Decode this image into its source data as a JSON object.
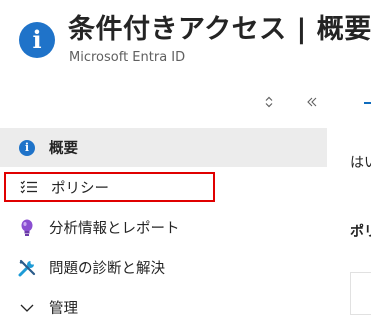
{
  "header": {
    "title": "条件付きアクセス | 概要",
    "subtitle": "Microsoft Entra ID",
    "icon": "info-icon"
  },
  "toolbar": {
    "sort_icon": "sort-up-down-icon",
    "collapse_icon": "double-chevron-left-icon"
  },
  "nav": {
    "items": [
      {
        "label": "概要",
        "icon": "info-icon"
      },
      {
        "label": "ポリシー",
        "icon": "list-icon"
      },
      {
        "label": "分析情報とレポート",
        "icon": "lightbulb-icon"
      },
      {
        "label": "問題の診断と解決",
        "icon": "wrench-icon"
      },
      {
        "label": "管理",
        "icon": "chevron-down-icon"
      }
    ]
  },
  "right_pane": {
    "text1": "はい",
    "text2": "ポリ"
  },
  "colors": {
    "accent": "#1f73c9",
    "highlight_border": "#e00000",
    "selected_bg": "#ececec"
  }
}
